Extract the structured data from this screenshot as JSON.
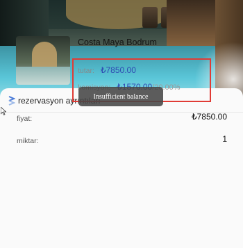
{
  "section": {
    "title": "rezervasyon ayrıntıları",
    "icon": "chevrons-stack-icon"
  },
  "hotel": {
    "name": "Costa Maya Bodrum"
  },
  "payment": {
    "amount_label": "tutar:",
    "amount_value": "₺7850.00",
    "commission_label": "komisyon:",
    "commission_value": "₺1570.00",
    "commission_percent": "/20.00%"
  },
  "toast": {
    "message": "Insufficient balance"
  },
  "details": {
    "price_label": "fiyat:",
    "price_value": "₺7850.00",
    "quantity_label": "miktar:",
    "quantity_value": "1"
  },
  "colors": {
    "accent": "#2f4bb3",
    "highlight_border": "#e03b35",
    "toast_bg": "#464646"
  }
}
